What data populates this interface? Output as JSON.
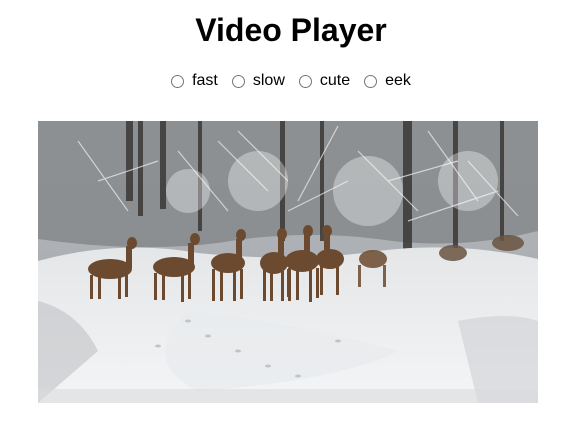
{
  "page": {
    "title": "Video Player"
  },
  "playback_options": [
    {
      "label": "fast",
      "checked": false
    },
    {
      "label": "slow",
      "checked": false
    },
    {
      "label": "cute",
      "checked": false
    },
    {
      "label": "eek",
      "checked": false
    }
  ],
  "video": {
    "scene": "deer-in-snowy-forest-frame"
  }
}
